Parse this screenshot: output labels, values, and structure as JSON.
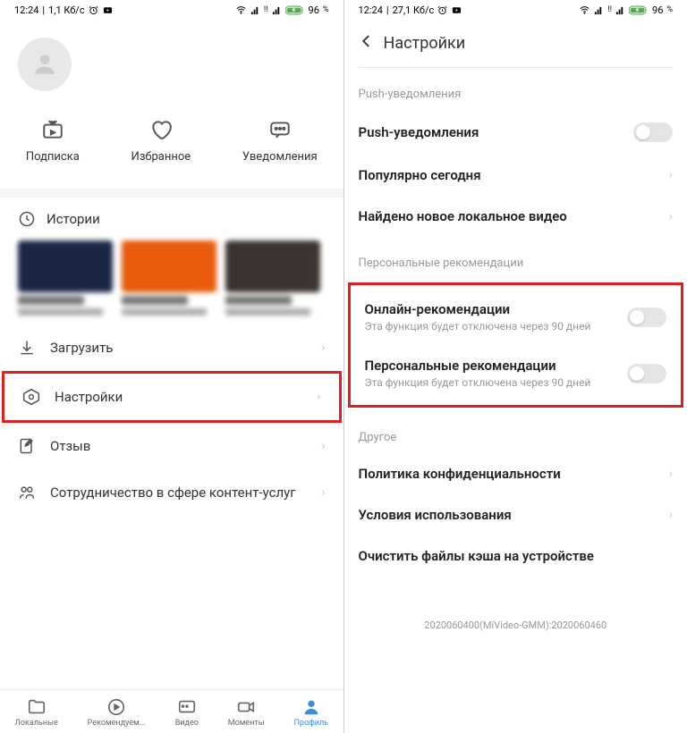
{
  "status": {
    "time": "12:24",
    "speed1": "1,1 Кб/с",
    "speed2": "27,1 Кб/с",
    "battery": "96",
    "batt_sfx": "%"
  },
  "profile": {
    "actions": {
      "sub": "Подписка",
      "fav": "Избранное",
      "notif": "Уведомления"
    },
    "histories": "Истории",
    "menu": {
      "download": "Загрузить",
      "settings": "Настройки",
      "feedback": "Отзыв",
      "collab": "Сотрудничество в сфере контент-услуг"
    }
  },
  "nav": {
    "local": "Локальные",
    "rec": "Рекомендуем...",
    "video": "Видео",
    "moments": "Моменты",
    "profile": "Профиль"
  },
  "settings": {
    "title": "Настройки",
    "push_section": "Push-уведомления",
    "push_row": "Push-уведомления",
    "popular": "Популярно сегодня",
    "local_video": "Найдено новое локальное видео",
    "rec_section": "Персональные рекомендации",
    "online_rec": "Онлайн-рекомендации",
    "online_rec_sub": "Эта функция будет отключена через 90 дней",
    "personal_rec": "Персональные рекомендации",
    "personal_rec_sub": "Эта функция будет отключена через 90 дней",
    "other_section": "Другое",
    "privacy": "Политика конфиденциальности",
    "terms": "Условия использования",
    "clear_cache": "Очистить файлы кэша на устройстве",
    "version": "2020060400(MiVideo-GMM):2020060460"
  }
}
